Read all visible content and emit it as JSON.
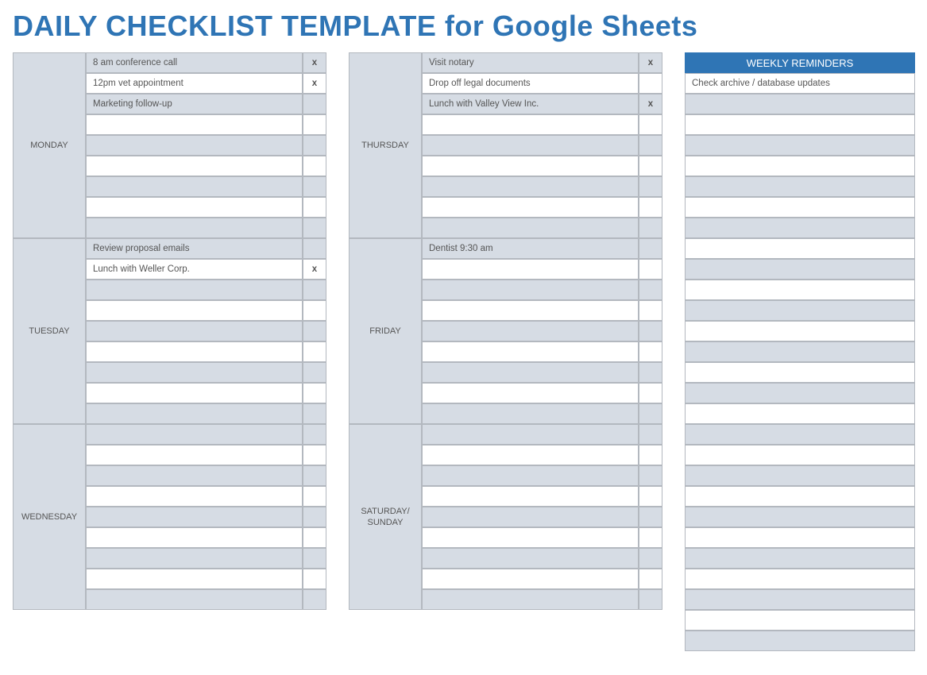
{
  "title": "DAILY CHECKLIST TEMPLATE for Google Sheets",
  "rows_per_day": 9,
  "reminder_rows": 28,
  "left_days": [
    {
      "label": "MONDAY",
      "tasks": [
        "8 am conference call",
        "12pm vet appointment",
        "Marketing follow-up",
        "",
        "",
        "",
        "",
        "",
        ""
      ],
      "marks": [
        "x",
        "x",
        "",
        "",
        "",
        "",
        "",
        "",
        ""
      ]
    },
    {
      "label": "TUESDAY",
      "tasks": [
        "Review proposal emails",
        "Lunch with Weller Corp.",
        "",
        "",
        "",
        "",
        "",
        "",
        ""
      ],
      "marks": [
        "",
        "x",
        "",
        "",
        "",
        "",
        "",
        "",
        ""
      ]
    },
    {
      "label": "WEDNESDAY",
      "tasks": [
        "",
        "",
        "",
        "",
        "",
        "",
        "",
        "",
        ""
      ],
      "marks": [
        "",
        "",
        "",
        "",
        "",
        "",
        "",
        "",
        ""
      ]
    }
  ],
  "right_days": [
    {
      "label": "THURSDAY",
      "tasks": [
        "Visit notary",
        "Drop off legal documents",
        "Lunch with Valley View Inc.",
        "",
        "",
        "",
        "",
        "",
        ""
      ],
      "marks": [
        "x",
        "",
        "x",
        "",
        "",
        "",
        "",
        "",
        ""
      ]
    },
    {
      "label": "FRIDAY",
      "tasks": [
        "Dentist 9:30 am",
        "",
        "",
        "",
        "",
        "",
        "",
        "",
        ""
      ],
      "marks": [
        "",
        "",
        "",
        "",
        "",
        "",
        "",
        "",
        ""
      ]
    },
    {
      "label": "SATURDAY/ SUNDAY",
      "tasks": [
        "",
        "",
        "",
        "",
        "",
        "",
        "",
        "",
        ""
      ],
      "marks": [
        "",
        "",
        "",
        "",
        "",
        "",
        "",
        "",
        ""
      ]
    }
  ],
  "reminders": {
    "header": "WEEKLY REMINDERS",
    "items": [
      "Check archive / database updates",
      "",
      "",
      "",
      "",
      "",
      "",
      "",
      "",
      "",
      "",
      "",
      "",
      "",
      "",
      "",
      "",
      "",
      "",
      "",
      "",
      "",
      "",
      "",
      "",
      "",
      "",
      ""
    ]
  }
}
